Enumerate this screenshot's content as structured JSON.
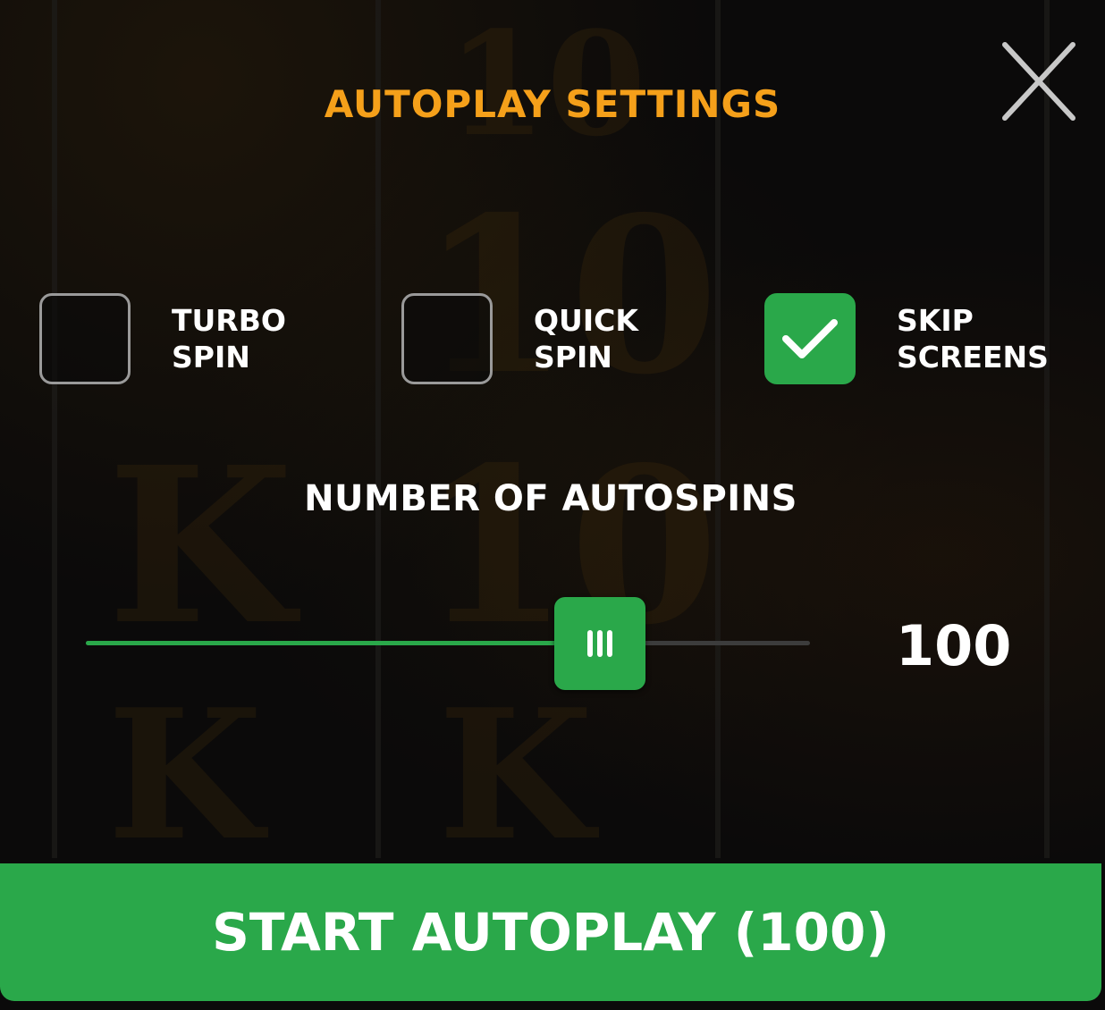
{
  "dialog": {
    "title": "AUTOPLAY SETTINGS",
    "close_icon": "close-icon"
  },
  "options": [
    {
      "label": "TURBO\nSPIN",
      "checked": false
    },
    {
      "label": "QUICK\nSPIN",
      "checked": false
    },
    {
      "label": "SKIP\nSCREENS",
      "checked": true
    }
  ],
  "autospins": {
    "label": "NUMBER OF AUTOSPINS",
    "value": "100",
    "slider_fraction": 0.71,
    "thumb_icon": "grip-icon"
  },
  "start_button": {
    "label": "START AUTOPLAY (100)"
  },
  "colors": {
    "accent_green": "#2aa84a",
    "title_orange": "#f5a01a",
    "background": "#0b0a0a"
  }
}
